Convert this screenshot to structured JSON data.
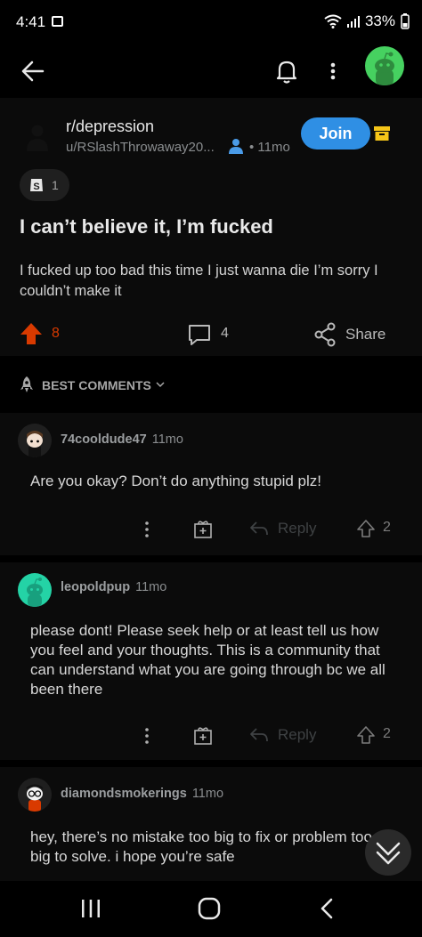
{
  "status_bar": {
    "time": "4:41",
    "battery": "33%"
  },
  "top_bar": {
    "back_icon": "arrow-left-icon",
    "notifications_icon": "bell-icon",
    "more_icon": "more-vertical-icon",
    "avatar": "snoo-avatar"
  },
  "post": {
    "subreddit": "r/depression",
    "author": "u/RSlashThrowaway20...",
    "age": "• 11mo",
    "join_label": "Join",
    "award_count": "1",
    "title": "I can’t believe it, I’m fucked",
    "body": "I fucked up too bad this time I just wanna die I’m sorry I couldn’t make it",
    "votes": "8",
    "comment_count": "4",
    "share_label": "Share"
  },
  "sort": {
    "label": "BEST COMMENTS"
  },
  "comments": [
    {
      "author": "74cooldude47",
      "age": "11mo",
      "text": "Are you okay? Don’t do anything stupid plz!",
      "reply_label": "Reply",
      "score": "2"
    },
    {
      "author": "leopoldpup",
      "age": "11mo",
      "text": "please dont! Please seek help or at least tell us how you feel and your thoughts. This is a community that can understand what you are going through bc we all been there",
      "reply_label": "Reply",
      "score": "2"
    },
    {
      "author": "diamondsmokerings",
      "age": "11mo",
      "text": "hey, there’s no mistake too big to fix or problem too big to solve. i hope you’re safe"
    }
  ],
  "colors": {
    "background": "#000000",
    "card": "#0b0b0b",
    "accent_blue": "#2f8fe4",
    "upvote_orange": "#d93a00",
    "avatar_green": "#46d160",
    "avatar_teal": "#24d3a6",
    "mod_yellow": "#f5c518"
  }
}
